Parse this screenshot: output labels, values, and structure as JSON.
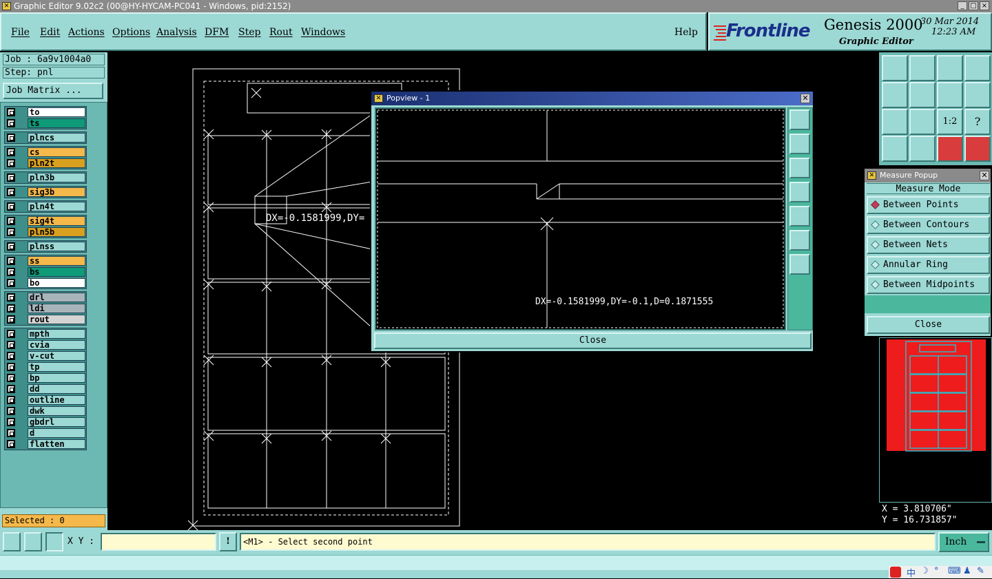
{
  "window": {
    "title": "Graphic Editor 9.02c2 (00@HY-HYCAM-PC041 - Windows, pid:2152)",
    "controls": [
      "_",
      "□",
      "×"
    ]
  },
  "menu": {
    "items": [
      "File",
      "Edit",
      "Actions",
      "Options",
      "Analysis",
      "DFM",
      "Step",
      "Rout",
      "Windows"
    ],
    "help": "Help"
  },
  "branding": {
    "logo": "Frontline",
    "product": "Genesis 2000",
    "subtitle": "Graphic Editor",
    "date": "30 Mar 2014",
    "time": "12:23 AM"
  },
  "job": {
    "job_line": "Job : 6a9v1004a0",
    "step_line": "Step: pnl",
    "matrix_button": "Job Matrix ..."
  },
  "layers": [
    {
      "group": 1,
      "items": [
        {
          "name": "to",
          "color": "#ffffff"
        },
        {
          "name": "ts",
          "color": "#0f9a78"
        }
      ]
    },
    {
      "group": 2,
      "items": [
        {
          "name": "plncs",
          "color": "#9cd8d4"
        }
      ]
    },
    {
      "group": 3,
      "items": [
        {
          "name": "cs",
          "color": "#f5b84a"
        },
        {
          "name": "pln2t",
          "color": "#d9a020"
        }
      ]
    },
    {
      "group": 4,
      "items": [
        {
          "name": "pln3b",
          "color": "#9cd8d4"
        }
      ]
    },
    {
      "group": 5,
      "items": [
        {
          "name": "sig3b",
          "color": "#f5b84a"
        }
      ]
    },
    {
      "group": 6,
      "items": [
        {
          "name": "pln4t",
          "color": "#9cd8d4"
        }
      ]
    },
    {
      "group": 7,
      "items": [
        {
          "name": "sig4t",
          "color": "#f5b84a"
        },
        {
          "name": "pln5b",
          "color": "#d9a020"
        }
      ]
    },
    {
      "group": 8,
      "items": [
        {
          "name": "plnss",
          "color": "#9cd8d4"
        }
      ]
    },
    {
      "group": 9,
      "items": [
        {
          "name": "ss",
          "color": "#f5b84a"
        },
        {
          "name": "bs",
          "color": "#0f9a78"
        },
        {
          "name": "bo",
          "color": "#ffffff"
        }
      ]
    },
    {
      "group": 10,
      "items": [
        {
          "name": "drl",
          "color": "#a7b5bb"
        },
        {
          "name": "ldi",
          "color": "#a7b5bb"
        },
        {
          "name": "rout",
          "color": "#d4d4d4"
        }
      ]
    },
    {
      "group": 11,
      "items": [
        {
          "name": "mpth",
          "color": "#9cd8d4"
        },
        {
          "name": "cvia",
          "color": "#9cd8d4"
        },
        {
          "name": "v-cut",
          "color": "#9cd8d4"
        },
        {
          "name": "tp",
          "color": "#9cd8d4"
        },
        {
          "name": "bp",
          "color": "#9cd8d4"
        },
        {
          "name": "dd",
          "color": "#9cd8d4"
        },
        {
          "name": "outline",
          "color": "#9cd8d4"
        },
        {
          "name": "dwk",
          "color": "#9cd8d4"
        },
        {
          "name": "gbdrl",
          "color": "#9cd8d4"
        },
        {
          "name": "d",
          "color": "#9cd8d4"
        },
        {
          "name": "flatten",
          "color": "#9cd8d4"
        }
      ]
    }
  ],
  "selected": "Selected : 0",
  "canvas": {
    "measure_label": "DX=-0.1581999,DY="
  },
  "popview": {
    "title": "Popview - 1",
    "measure_text": "DX=-0.1581999,DY=-0.1,D=0.1871555",
    "close": "Close"
  },
  "measure_popup": {
    "title": "Measure Popup",
    "heading": "Measure Mode",
    "options": [
      "Between Points",
      "Between Contours",
      "Between Nets",
      "Annular Ring",
      "Between Midpoints"
    ],
    "selected_index": 0,
    "close": "Close"
  },
  "toolbox": {
    "scale_icon_text": "1:2"
  },
  "coords": {
    "x": "X = 3.810706\"",
    "y": "Y = 16.731857\""
  },
  "status": {
    "xy_label": "X Y :",
    "xy_value": "",
    "message": "<M1> - Select second point",
    "units": "Inch"
  }
}
